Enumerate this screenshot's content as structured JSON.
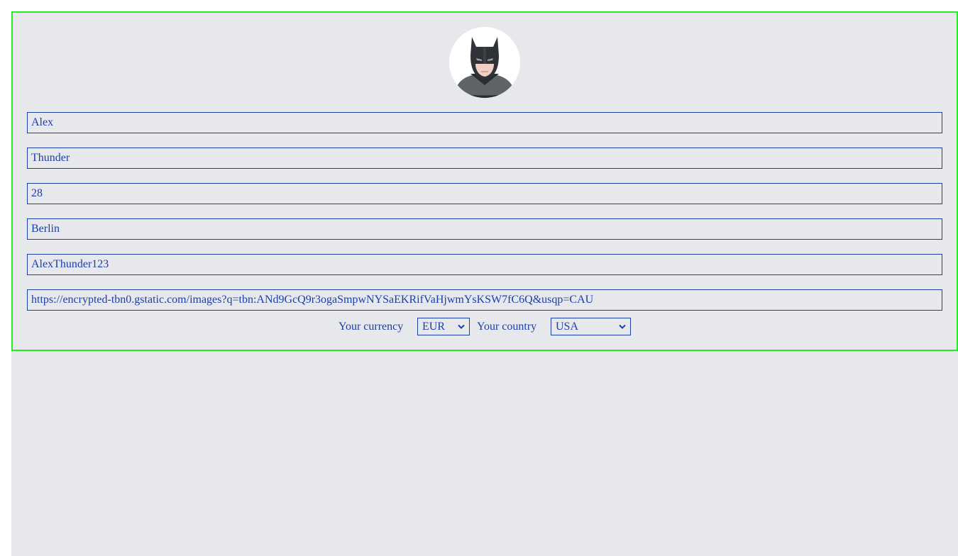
{
  "profile": {
    "first_name": "Alex",
    "last_name": "Thunder",
    "age": "28",
    "city": "Berlin",
    "username": "AlexThunder123",
    "avatar_url": "https://encrypted-tbn0.gstatic.com/images?q=tbn:ANd9GcQ9r3ogaSmpwNYSaEKRifVaHjwmYsKSW7fC6Q&usqp=CAU"
  },
  "selectors": {
    "currency_label": "Your currency",
    "currency_value": "EUR",
    "country_label": "Your country",
    "country_value": "USA"
  },
  "colors": {
    "accent": "#1c3fa6",
    "border_highlight": "#22ee22",
    "background": "#e7e8eb"
  },
  "icons": {
    "avatar": "batman-avatar-icon",
    "dropdown": "chevron-down-icon"
  }
}
